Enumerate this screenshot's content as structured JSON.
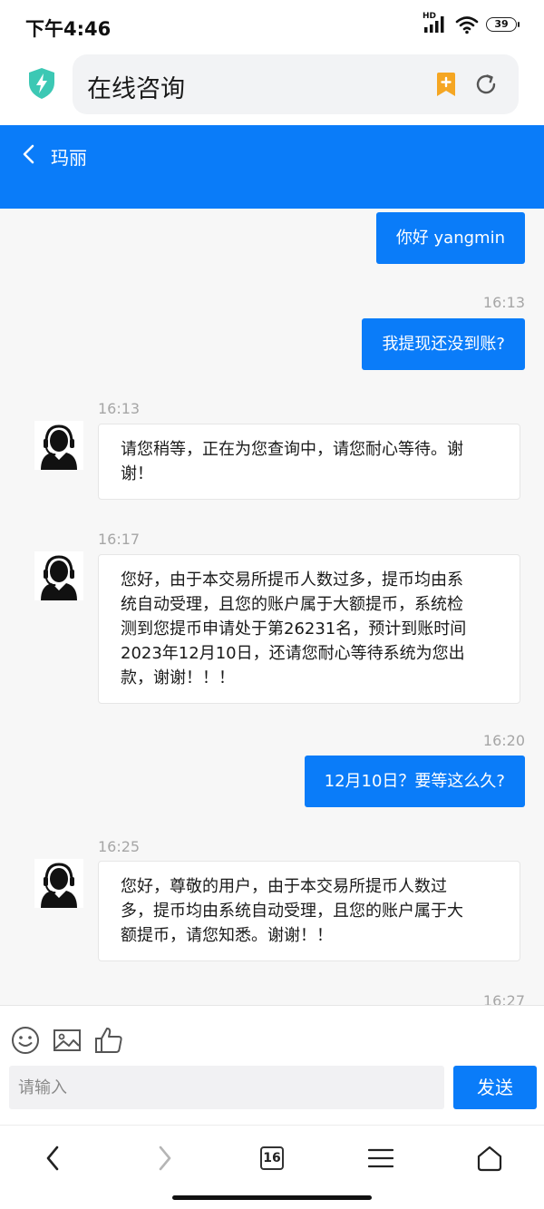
{
  "status_bar": {
    "time": "下午4:46",
    "hd_label": "HD",
    "battery": "39"
  },
  "browser": {
    "address": "在线咨询"
  },
  "chat_header": {
    "title": "玛丽"
  },
  "messages": [
    {
      "direction": "out",
      "text": "你好 yangmin"
    },
    {
      "direction": "out",
      "time": "16:13",
      "text": "我提现还没到账?"
    },
    {
      "direction": "in",
      "time": "16:13",
      "lines": [
        "请您稍等，正在为您查询中，请您耐心等待。谢",
        "谢！"
      ]
    },
    {
      "direction": "in",
      "time": "16:17",
      "lines": [
        "您好，由于本交易所提币人数过多，提币均由系",
        "统自动受理，且您的账户属于大额提币，系统检",
        "测到您提币申请处于第26231名，预计到账时间",
        "2023年12月10日，还请您耐心等待系统为您出",
        "款，谢谢！！！"
      ]
    },
    {
      "direction": "out",
      "time": "16:20",
      "text": "12月10日？要等这么久?"
    },
    {
      "direction": "in",
      "time": "16:25",
      "lines": [
        "您好，尊敬的用户，由于本交易所提币人数过",
        "多，提币均由系统自动受理，且您的账户属于大",
        "额提币，请您知悉。谢谢！！"
      ]
    },
    {
      "direction": "out",
      "time": "16:27"
    }
  ],
  "composer": {
    "placeholder": "请输入",
    "send_label": "发送"
  },
  "bottom_nav": {
    "tab_count": "16"
  },
  "colors": {
    "accent": "#0a7cf9",
    "chat_bg": "#f7f7f7",
    "timestamp": "#a6a6a6",
    "shield": "#3cc8b4",
    "bookmark": "#f5a623"
  },
  "icons": [
    "shield-bolt-icon",
    "bookmark-add-icon",
    "reload-icon",
    "back-chevron-icon",
    "agent-avatar-icon",
    "emoji-icon",
    "image-icon",
    "thumbs-up-icon",
    "nav-back-icon",
    "nav-forward-icon",
    "tabs-icon",
    "menu-icon",
    "home-icon"
  ]
}
